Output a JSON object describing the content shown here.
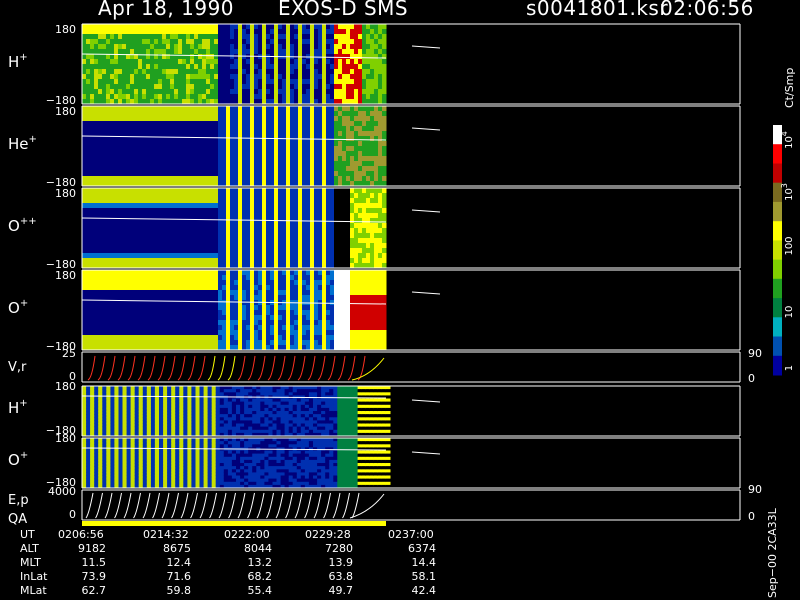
{
  "header": {
    "date": "Apr 18, 1990",
    "instrument": "EXOS-D SMS",
    "file": "s0041801.ksr",
    "time": "02:06:56"
  },
  "panels": [
    {
      "label": "H",
      "sup": "+",
      "top_tick": "180",
      "bottom_tick": "−180"
    },
    {
      "label": "He",
      "sup": "+",
      "top_tick": "180",
      "bottom_tick": "−180"
    },
    {
      "label": "O",
      "sup": "++",
      "top_tick": "180",
      "bottom_tick": "−180"
    },
    {
      "label": "O",
      "sup": "+",
      "top_tick": "180",
      "bottom_tick": "−180"
    }
  ],
  "vr_panel": {
    "label": "V,r",
    "top_tick": "25",
    "bottom_tick": "0",
    "right_top": "90",
    "right_bottom": "0"
  },
  "lower_panels": [
    {
      "label": "H",
      "sup": "+",
      "top_tick": "180",
      "bottom_tick": "−180"
    },
    {
      "label": "O",
      "sup": "+",
      "top_tick": "180",
      "bottom_tick": "−180"
    }
  ],
  "ep_panel": {
    "label": "E,p",
    "top_tick": "4000",
    "bottom_tick": "0",
    "right_top": "90",
    "right_bottom": "0"
  },
  "qa_label": "QA",
  "colorbar": {
    "unit": "Ct/Smp",
    "ticks": [
      {
        "base": "10",
        "exp": "4"
      },
      {
        "base": "10",
        "exp": "3"
      },
      {
        "base": "100",
        "exp": ""
      },
      {
        "base": "10",
        "exp": ""
      },
      {
        "base": "1",
        "exp": ""
      }
    ],
    "colors": [
      "#ffffff",
      "#ff0000",
      "#c00000",
      "#7a6a20",
      "#a09a30",
      "#ffff00",
      "#c8e000",
      "#80d000",
      "#20a020",
      "#008040",
      "#00b0c0",
      "#0050b0",
      "#0000a0"
    ]
  },
  "footer_rows": [
    {
      "name": "UT",
      "values": [
        "0206:56",
        "0214:32",
        "0222:00",
        "0229:28",
        "0237:00"
      ]
    },
    {
      "name": "ALT",
      "values": [
        "9182",
        "8675",
        "8044",
        "7280",
        "6374"
      ]
    },
    {
      "name": "MLT",
      "values": [
        "11.5",
        "12.4",
        "13.2",
        "13.9",
        "14.4"
      ]
    },
    {
      "name": "InLat",
      "values": [
        "73.9",
        "71.6",
        "68.2",
        "63.8",
        "58.1"
      ]
    },
    {
      "name": "MLat",
      "values": [
        "62.7",
        "59.8",
        "55.4",
        "49.7",
        "42.4"
      ]
    }
  ],
  "side_note": "Sep−00 2CA33L",
  "chart_data": {
    "type": "heatmap",
    "title": "Apr 18, 1990  EXOS-D SMS",
    "x_tick_labels": [
      "0206:56",
      "0214:32",
      "0222:00",
      "0229:28",
      "0237:00"
    ],
    "panels": [
      "H+",
      "He+",
      "O++",
      "O+",
      "V,r",
      "H+",
      "O+",
      "E,p"
    ],
    "y_range_pitch": [
      -180,
      180
    ],
    "y_range_vr": [
      0,
      25
    ],
    "y_range_ep": [
      0,
      4000
    ],
    "colorbar_unit": "Ct/Smp",
    "colorbar_ticks": [
      "1",
      "10",
      "100",
      "10^3",
      "10^4"
    ]
  }
}
